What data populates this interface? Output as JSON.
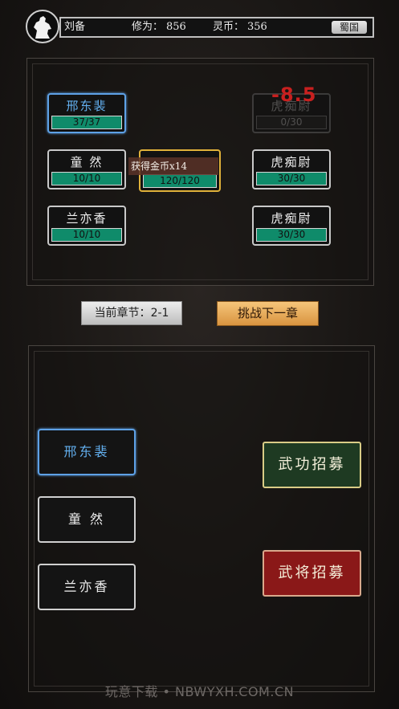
{
  "header": {
    "player_name": "刘备",
    "cultivation_label": "修为：",
    "cultivation_value": "856",
    "coins_label": "灵币：",
    "coins_value": "356",
    "kingdom": "蜀国"
  },
  "battle": {
    "allies": [
      {
        "name": "邢东裴",
        "hp": "37/37",
        "state": "selected"
      },
      {
        "name": "童 然",
        "hp": "10/10",
        "state": "normal"
      },
      {
        "name": "兰亦香",
        "hp": "10/10",
        "state": "normal"
      }
    ],
    "active_hero": {
      "name": "",
      "hp": "120/120",
      "state": "gold"
    },
    "enemies": [
      {
        "name": "虎痴尉",
        "hp": "0/30",
        "state": "dead"
      },
      {
        "name": "虎痴尉",
        "hp": "30/30",
        "state": "normal"
      },
      {
        "name": "虎痴尉",
        "hp": "30/30",
        "state": "normal"
      }
    ],
    "damage_popup": "-8.5",
    "reward_popup": "获得金币x14"
  },
  "chapter": {
    "label": "当前章节：",
    "value": "2-1",
    "next_button": "挑战下一章"
  },
  "roster": [
    {
      "name": "邢东裴",
      "selected": true
    },
    {
      "name": "童 然",
      "selected": false
    },
    {
      "name": "兰亦香",
      "selected": false
    }
  ],
  "recruit": {
    "martial_button": "武功招募",
    "general_button": "武将招募"
  },
  "watermark": "玩意下载 • NBWYXH.COM.CN",
  "colors": {
    "hp_green": "#0f8b6a",
    "selected_blue": "#5ea1e6",
    "damage_red": "#c8201f",
    "next_button_gold": "#d99440"
  }
}
